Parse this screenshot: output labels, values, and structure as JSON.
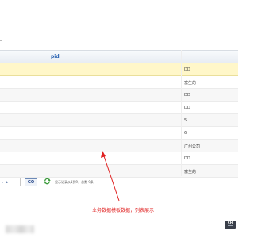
{
  "grid": {
    "columns": [
      {
        "label": "pid"
      }
    ],
    "rows": [
      {
        "last": "DD"
      },
      {
        "last": "富生的"
      },
      {
        "last": "DD"
      },
      {
        "last": "DD"
      },
      {
        "last": "5"
      },
      {
        "last": "6"
      },
      {
        "last": "广州公司"
      },
      {
        "last": "DD"
      },
      {
        "last": "富生的"
      }
    ]
  },
  "pager": {
    "nav": "▸ ▸|",
    "go_label": "GO",
    "info": "显示记录从1到9，总数 9条"
  },
  "annotation": "业务数据模板数据，列表展示",
  "badge": {
    "label": "CH"
  },
  "colors": {
    "selected_row": "#fff7c9",
    "header_text": "#2a63b2",
    "annotation": "#e02020"
  }
}
